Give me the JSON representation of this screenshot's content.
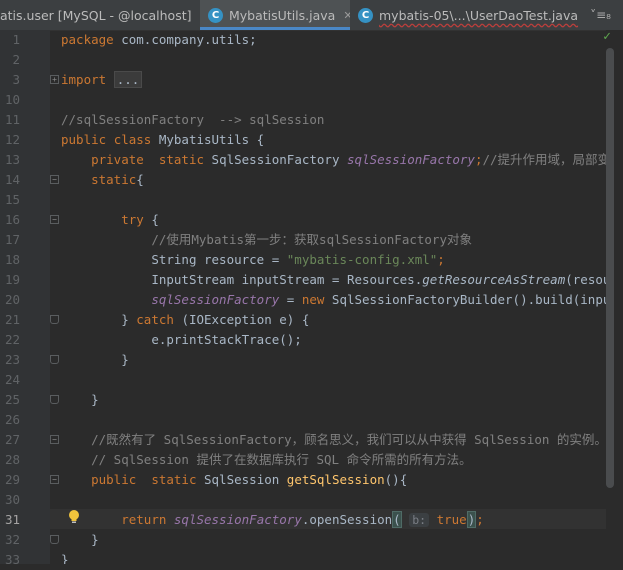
{
  "tabs": [
    {
      "label": "atis.user [MySQL - @localhost]",
      "close": "✕",
      "icon": "database-console-icon"
    },
    {
      "label": "MybatisUtils.java",
      "close": "✕",
      "icon": "java-class-icon",
      "icon_letter": "C",
      "active": true
    },
    {
      "label": "mybatis-05\\...\\UserDaoTest.java",
      "close": "✕",
      "icon": "java-class-icon",
      "icon_letter": "C"
    }
  ],
  "tab_menu": "˅≡₈",
  "inspection_status": "✓",
  "line_numbers": [
    "1",
    "2",
    "3",
    "10",
    "11",
    "12",
    "13",
    "14",
    "15",
    "16",
    "17",
    "18",
    "19",
    "20",
    "21",
    "22",
    "23",
    "24",
    "25",
    "26",
    "27",
    "28",
    "29",
    "30",
    "31",
    "32",
    "33"
  ],
  "current_line": "31",
  "code": {
    "l1_package": "package",
    "l1_name": " com.company.utils;",
    "l3_import": "import",
    "l3_ellipsis": "...",
    "l11_comment": "//sqlSessionFactory  --> sqlSession",
    "l12_public": "public",
    "l12_class": "class",
    "l12_name": " MybatisUtils {",
    "l13_private": "private",
    "l13_static": "static",
    "l13_type": " SqlSessionFactory ",
    "l13_field": "sqlSessionFactory",
    "l13_rest": ";",
    "l13_comment": "//提升作用域，局部变全局变量",
    "l14_static": "static",
    "l14_brace": "{",
    "l16_try": "try",
    "l16_brace": " {",
    "l17_comment": "//使用Mybatis第一步：获取sqlSessionFactory对象",
    "l18_type": "String resource = ",
    "l18_string": "\"mybatis-config.xml\"",
    "l18_end": ";",
    "l19_decl": "InputStream inputStream = Resources.",
    "l19_method": "getResourceAsStream",
    "l19_end": "(resource);",
    "l20_field": "sqlSessionFactory",
    "l20_eq": " = ",
    "l20_new": "new",
    "l20_rest": " SqlSessionFactoryBuilder().build(inputStream);",
    "l21_brace": "} ",
    "l21_catch": "catch",
    "l21_rest": " (IOException e) {",
    "l22_text": "e.printStackTrace();",
    "l23_text": "}",
    "l25_text": "}",
    "l27_comment": "//既然有了 SqlSessionFactory，顾名思义，我们可以从中获得 SqlSession 的实例。",
    "l28_comment": "// SqlSession 提供了在数据库执行 SQL 命令所需的所有方法。",
    "l29_public": "public",
    "l29_static": "static",
    "l29_type": " SqlSession ",
    "l29_method": "getSqlSession",
    "l29_end": "(){",
    "l31_return": "return",
    "l31_field": "sqlSessionFactory",
    "l31_call": ".openSession",
    "l31_paren_open": "(",
    "l31_hint": "b:",
    "l31_true": "true",
    "l31_paren_close": ")",
    "l31_end": ";",
    "l32_text": "}",
    "l33_text": "}"
  },
  "colors": {
    "background": "#2b2b2b",
    "keyword": "#cc7832",
    "comment": "#808080",
    "string": "#6a8759",
    "static_field": "#9876aa",
    "method_decl": "#ffc66d",
    "default_text": "#a9b7c6"
  }
}
